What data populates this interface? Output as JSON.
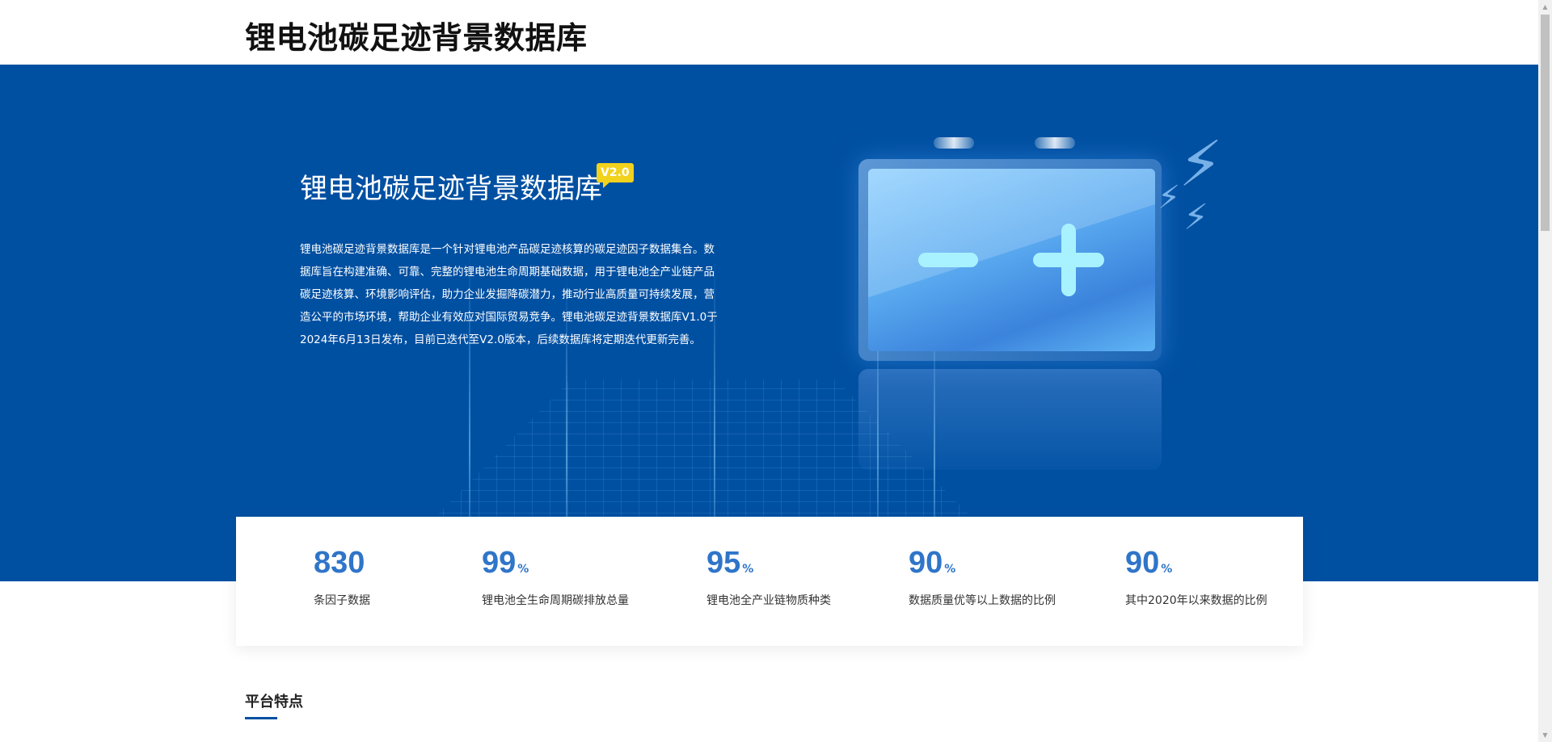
{
  "header": {
    "site_title": "锂电池碳足迹背景数据库"
  },
  "hero": {
    "heading": "锂电池碳足迹背景数据库",
    "version_badge": "V2.0",
    "description": "锂电池碳足迹背景数据库是一个针对锂电池产品碳足迹核算的碳足迹因子数据集合。数据库旨在构建准确、可靠、完整的锂电池生命周期基础数据，用于锂电池全产业链产品碳足迹核算、环境影响评估，助力企业发掘降碳潜力，推动行业高质量可持续发展，营造公平的市场环境，帮助企业有效应对国际贸易竞争。锂电池碳足迹背景数据库V1.0于2024年6月13日发布，目前已迭代至V2.0版本，后续数据库将定期迭代更新完善。",
    "illustration_icons": [
      "battery-icon",
      "minus-icon",
      "plus-icon",
      "lightning-bolt-icon"
    ]
  },
  "stats": [
    {
      "value": "830",
      "unit": "",
      "label": "条因子数据"
    },
    {
      "value": "99",
      "unit": "%",
      "label": "锂电池全生命周期碳排放总量"
    },
    {
      "value": "95",
      "unit": "%",
      "label": "锂电池全产业链物质种类"
    },
    {
      "value": "90",
      "unit": "%",
      "label": "数据质量优等以上数据的比例"
    },
    {
      "value": "90",
      "unit": "%",
      "label": "其中2020年以来数据的比例"
    }
  ],
  "section": {
    "title": "平台特点"
  },
  "colors": {
    "hero_background": "#0050a2",
    "accent_blue": "#2f75c9",
    "badge_yellow": "#f2d21c"
  }
}
